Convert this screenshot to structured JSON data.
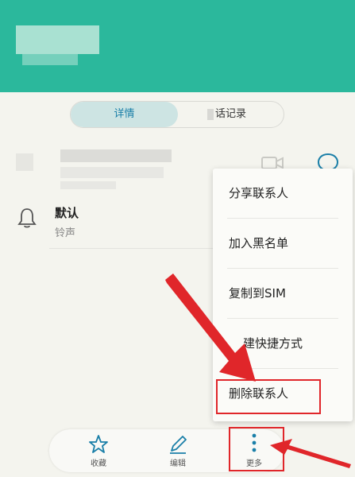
{
  "tabs": {
    "details": "详情",
    "call_log": "话记录"
  },
  "contact": {
    "ringtone_title": "默认",
    "ringtone_sub": "铃声"
  },
  "menu": {
    "items": [
      "分享联系人",
      "加入黑名单",
      "复制到SIM",
      "建快捷方式",
      "删除联系人"
    ]
  },
  "bottom_bar": {
    "favorite": "收藏",
    "edit": "编辑",
    "more": "更多"
  },
  "colors": {
    "header": "#2bb89c",
    "accent": "#1a7fa8",
    "annotation": "#e0262a"
  }
}
